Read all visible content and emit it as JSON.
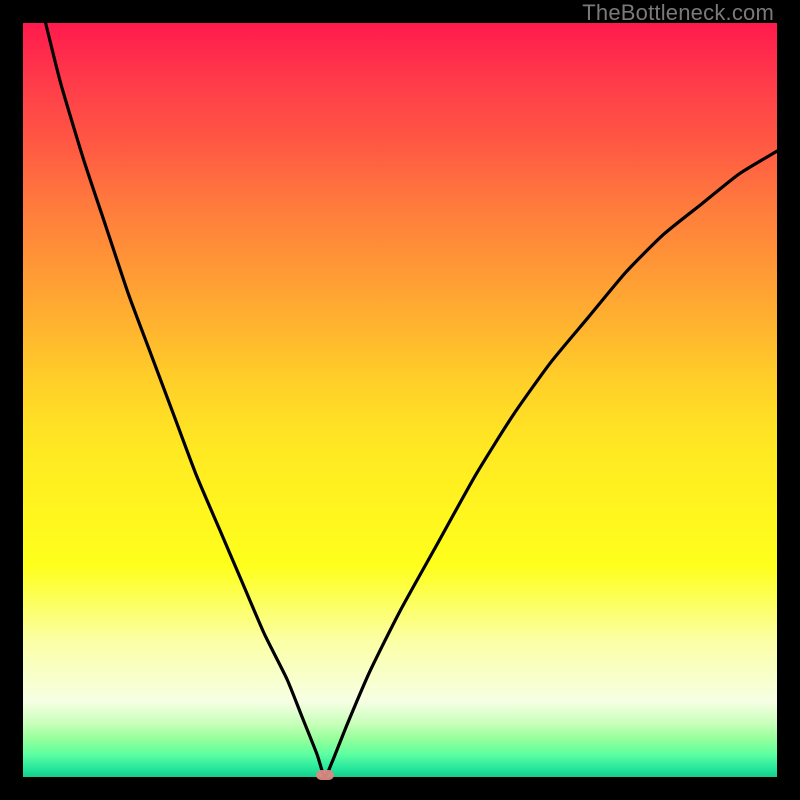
{
  "watermark": "TheBottleneck.com",
  "colors": {
    "page_bg": "#000000",
    "curve": "#000000",
    "marker": "#d98a84"
  },
  "chart_data": {
    "type": "line",
    "title": "",
    "xlabel": "",
    "ylabel": "",
    "xlim": [
      0,
      100
    ],
    "ylim": [
      0,
      100
    ],
    "grid": false,
    "legend": false,
    "minimum_marker": {
      "x": 40,
      "y": 0
    },
    "series": [
      {
        "name": "bottleneck-curve",
        "x": [
          3,
          5,
          8,
          11,
          14,
          17,
          20,
          23,
          26,
          29,
          32,
          35,
          37,
          39,
          40,
          41,
          43,
          46,
          50,
          55,
          60,
          65,
          70,
          75,
          80,
          85,
          90,
          95,
          100
        ],
        "y": [
          100,
          92,
          82,
          73,
          64,
          56,
          48,
          40,
          33,
          26,
          19,
          13,
          8,
          3,
          0,
          2,
          7,
          14,
          22,
          31,
          40,
          48,
          55,
          61,
          67,
          72,
          76,
          80,
          83
        ]
      }
    ]
  }
}
